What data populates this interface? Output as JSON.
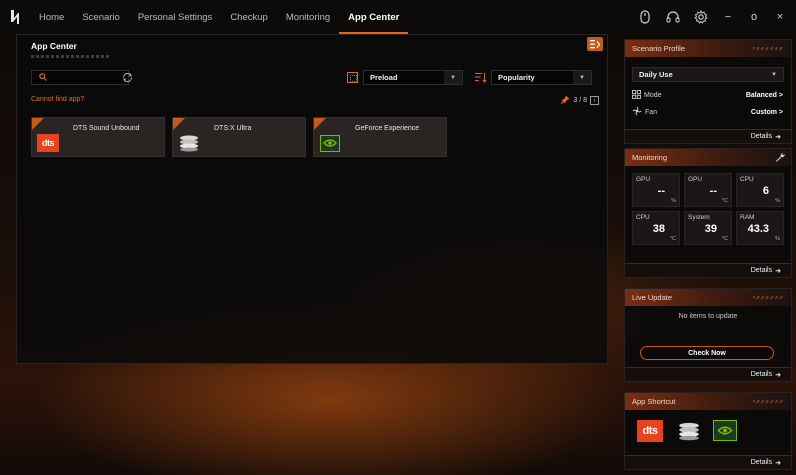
{
  "nav": {
    "tabs": [
      {
        "label": "Home"
      },
      {
        "label": "Scenario"
      },
      {
        "label": "Personal Settings"
      },
      {
        "label": "Checkup"
      },
      {
        "label": "Monitoring"
      },
      {
        "label": "App Center"
      }
    ],
    "active_tab": "App Center"
  },
  "window_controls": {
    "minimize": "−",
    "maximize": "o",
    "close": "×"
  },
  "main": {
    "title": "App Center",
    "search": {
      "value": "",
      "placeholder": ""
    },
    "cannot_find_link": "Cannot find app?",
    "preload_select": "Preload",
    "sort_select": "Popularity",
    "page_indicator": "3 / 8",
    "apps": [
      {
        "name": "DTS Sound Unbound",
        "icon": "dts-icon",
        "pinned": true
      },
      {
        "name": "DTS:X Ultra",
        "icon": "dtsx-icon",
        "pinned": true
      },
      {
        "name": "GeForce Experience",
        "icon": "nvidia-icon",
        "pinned": true
      }
    ]
  },
  "sidebar": {
    "scenario": {
      "title": "Scenario Profile",
      "profile": "Daily Use",
      "mode_label": "Mode",
      "mode_value": "Balanced >",
      "fan_label": "Fan",
      "fan_value": "Custom >",
      "details": "Details"
    },
    "monitoring": {
      "title": "Monitoring",
      "cells": [
        {
          "label": "GPU",
          "value": "--",
          "unit": "%"
        },
        {
          "label": "GPU",
          "value": "--",
          "unit": "°C"
        },
        {
          "label": "CPU",
          "value": "6",
          "unit": "%"
        },
        {
          "label": "CPU",
          "value": "38",
          "unit": "°C"
        },
        {
          "label": "System",
          "value": "39",
          "unit": "°C"
        },
        {
          "label": "RAM",
          "value": "43.3",
          "unit": "%"
        }
      ],
      "details": "Details"
    },
    "live_update": {
      "title": "Live Update",
      "status": "No items to update",
      "button": "Check Now",
      "details": "Details"
    },
    "shortcut": {
      "title": "App Shortcut",
      "apps": [
        "dts-icon",
        "dtsx-icon",
        "nvidia-icon"
      ],
      "details": "Details"
    }
  },
  "colors": {
    "accent": "#e8621a",
    "panel": "#0a0a0a"
  }
}
